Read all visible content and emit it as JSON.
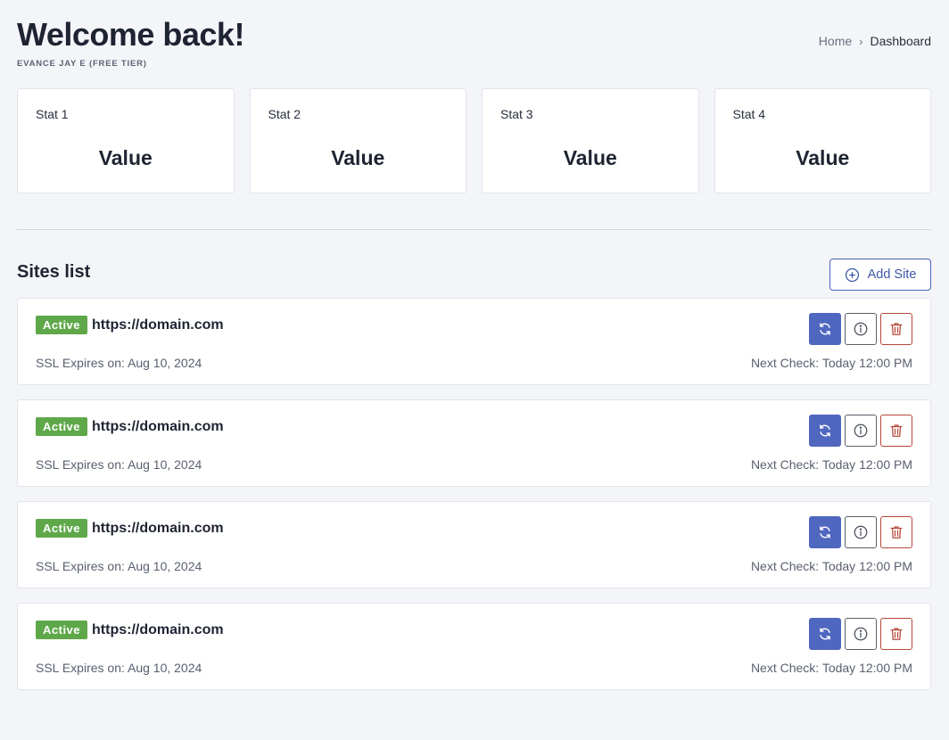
{
  "header": {
    "title": "Welcome back!",
    "subtitle": "EVANCE JAY E (FREE TIER)"
  },
  "breadcrumb": {
    "home": "Home",
    "separator": "›",
    "current": "Dashboard"
  },
  "stats": [
    {
      "label": "Stat 1",
      "value": "Value"
    },
    {
      "label": "Stat 2",
      "value": "Value"
    },
    {
      "label": "Stat 3",
      "value": "Value"
    },
    {
      "label": "Stat 4",
      "value": "Value"
    }
  ],
  "sites": {
    "title": "Sites list",
    "add_button_label": "Add Site",
    "items": [
      {
        "status": "Active",
        "url": "https://domain.com",
        "ssl_expiry": "SSL Expires on: Aug 10, 2024",
        "next_check": "Next Check: Today 12:00 PM"
      },
      {
        "status": "Active",
        "url": "https://domain.com",
        "ssl_expiry": "SSL Expires on: Aug 10, 2024",
        "next_check": "Next Check: Today 12:00 PM"
      },
      {
        "status": "Active",
        "url": "https://domain.com",
        "ssl_expiry": "SSL Expires on: Aug 10, 2024",
        "next_check": "Next Check: Today 12:00 PM"
      },
      {
        "status": "Active",
        "url": "https://domain.com",
        "ssl_expiry": "SSL Expires on: Aug 10, 2024",
        "next_check": "Next Check: Today 12:00 PM"
      }
    ]
  },
  "icons": {
    "add": "plus-circle-icon",
    "refresh": "refresh-icon",
    "info": "info-icon",
    "delete": "trash-icon"
  },
  "colors": {
    "accent": "#4a63b8",
    "refresh_button": "#5067c0",
    "status_active": "#5fa84a",
    "danger": "#b5483a",
    "background": "#f4f5f9"
  }
}
